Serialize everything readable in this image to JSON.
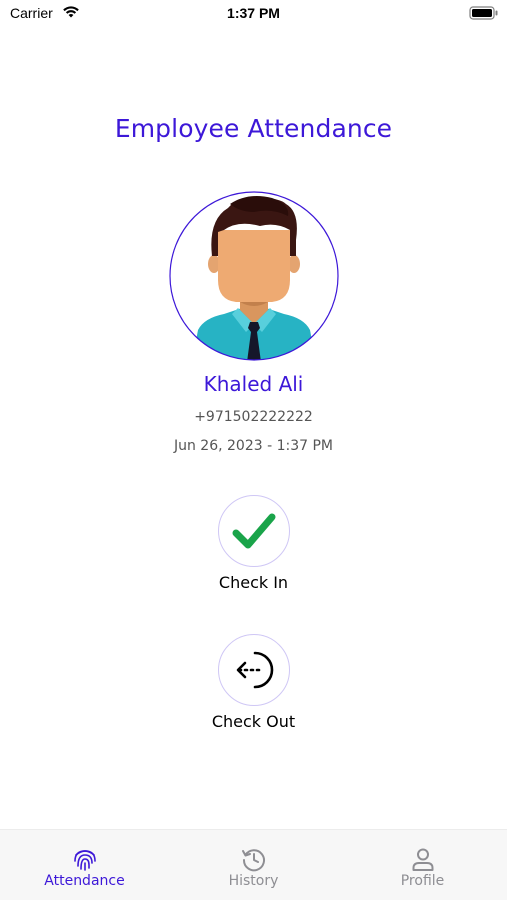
{
  "status_bar": {
    "carrier": "Carrier",
    "time": "1:37 PM"
  },
  "page": {
    "title": "Employee Attendance"
  },
  "employee": {
    "name": "Khaled Ali",
    "phone": "+971502222222",
    "datetime": "Jun 26, 2023 - 1:37 PM"
  },
  "actions": {
    "check_in": "Check In",
    "check_out": "Check Out"
  },
  "tabs": [
    {
      "label": "Attendance",
      "icon": "fingerprint-icon",
      "active": true
    },
    {
      "label": "History",
      "icon": "history-icon",
      "active": false
    },
    {
      "label": "Profile",
      "icon": "person-icon",
      "active": false
    }
  ],
  "colors": {
    "accent": "#3d18d8",
    "check_green": "#1aa44a",
    "inactive_tab": "#8e8e93",
    "tab_bar_bg": "#f7f7f7"
  }
}
